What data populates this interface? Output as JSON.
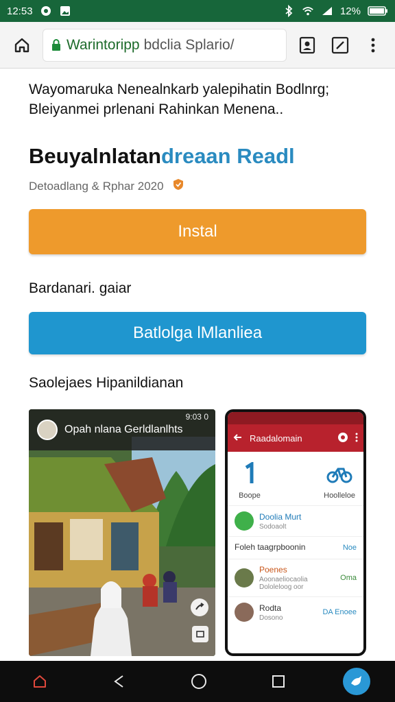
{
  "status": {
    "time": "12:53",
    "battery": "12%",
    "icons": [
      "notification-icon",
      "image-icon",
      "bluetooth-icon",
      "wifi-icon",
      "signal-icon",
      "battery-icon"
    ]
  },
  "browser": {
    "url_host": "Warintoripp",
    "url_rest": "bdclia Splario/",
    "icons": [
      "home-icon",
      "lock-icon",
      "reader-icon",
      "tabs-icon",
      "more-icon"
    ]
  },
  "page": {
    "description": "Wayomaruka Nenealnkarb yalepihatin Bodlnrg; Bleiyanmei prlenani Rahinkan Menena..",
    "title_main": "Beuyalnlatan",
    "title_accent": "dreaan Readl",
    "meta_text": "Detoadlang & Rphar 2020",
    "install_label": "Instal",
    "section1_label": "Bardanari. gaiar",
    "secondary_button_label": "Batlolga lMlanliea",
    "section2_label": "Saolejaes Hipanildianan"
  },
  "screenshot1": {
    "caption": "Opah nlana Gerldlanlhts",
    "time": "9:03 0"
  },
  "screenshot2": {
    "app_title": "Raadalomain",
    "tiles": [
      {
        "label": "Boope"
      },
      {
        "label": "Hoolleloe"
      }
    ],
    "items": [
      {
        "name": "Doolia Murt",
        "sub": "Sodoaolt",
        "right": ""
      },
      {
        "name": "Foleh taagrpboonin",
        "sub": "",
        "right": "Noe"
      },
      {
        "name": "Poenes",
        "sub": "Aoonaeliocaolia Dololeloog oor",
        "right": "Oma"
      },
      {
        "name": "Rodta",
        "sub": "Dosono",
        "right": "DA Enoee"
      }
    ]
  },
  "colors": {
    "status_bar": "#17663a",
    "install": "#ee9a2c",
    "secondary": "#1f96cf",
    "accent_title": "#2a8bc0",
    "phone_appbar": "#b8222d"
  },
  "navbar": {
    "icons": [
      "home-icon",
      "back-icon",
      "circle-home-icon",
      "recents-icon",
      "fab-bird-icon"
    ]
  }
}
